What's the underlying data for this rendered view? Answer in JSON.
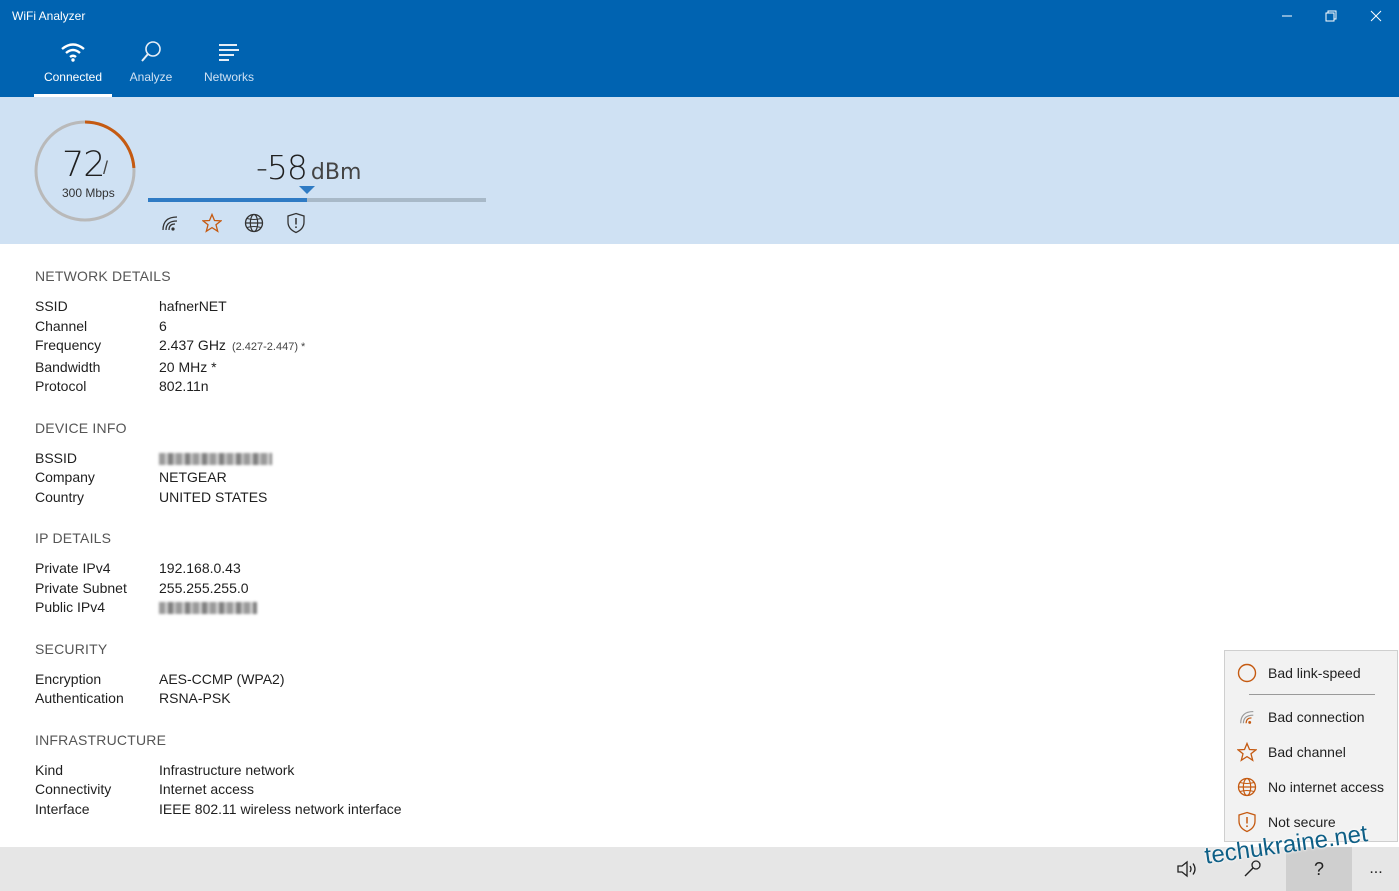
{
  "window": {
    "title": "WiFi Analyzer",
    "controls": [
      "minimize-icon",
      "restore-icon",
      "close-icon"
    ]
  },
  "nav": {
    "tabs": [
      {
        "label": "Connected",
        "icon": "wifi-icon",
        "active": true
      },
      {
        "label": "Analyze",
        "icon": "magnifier-icon",
        "active": false
      },
      {
        "label": "Networks",
        "icon": "list-icon",
        "active": false
      }
    ]
  },
  "status": {
    "link_speed": "72",
    "slash": "/",
    "max_speed": "300 Mbps",
    "link_speed_fraction": 0.24,
    "signal_dbm": "-58",
    "signal_unit": "dBm",
    "signal_level_fraction": 0.47,
    "icons": [
      "connection-icon",
      "star-icon",
      "globe-icon",
      "shield-icon"
    ]
  },
  "details": {
    "network": {
      "title": "NETWORK DETAILS",
      "rows": [
        {
          "label": "SSID",
          "value": "hafnerNET"
        },
        {
          "label": "Channel",
          "value": "6"
        },
        {
          "label": "Frequency",
          "value": "2.437 GHz",
          "extra": "(2.427-2.447) *"
        },
        {
          "label": "Bandwidth",
          "value": "20 MHz *"
        },
        {
          "label": "Protocol",
          "value": "802.11n"
        }
      ]
    },
    "device": {
      "title": "DEVICE INFO",
      "rows": [
        {
          "label": "BSSID",
          "value": ""
        },
        {
          "label": "Company",
          "value": "NETGEAR"
        },
        {
          "label": "Country",
          "value": "UNITED STATES"
        }
      ]
    },
    "ip": {
      "title": "IP DETAILS",
      "rows": [
        {
          "label": "Private IPv4",
          "value": "192.168.0.43"
        },
        {
          "label": "Private Subnet",
          "value": "255.255.255.0"
        },
        {
          "label": "Public IPv4",
          "value": ""
        }
      ]
    },
    "security": {
      "title": "SECURITY",
      "rows": [
        {
          "label": "Encryption",
          "value": "AES-CCMP (WPA2)"
        },
        {
          "label": "Authentication",
          "value": "RSNA-PSK"
        }
      ]
    },
    "infrastructure": {
      "title": "INFRASTRUCTURE",
      "rows": [
        {
          "label": "Kind",
          "value": "Infrastructure network"
        },
        {
          "label": "Connectivity",
          "value": "Internet access"
        },
        {
          "label": "Interface",
          "value": "IEEE 802.11 wireless network interface"
        }
      ]
    }
  },
  "legend": {
    "items": [
      {
        "label": "Bad link-speed",
        "icon": "circle-icon"
      },
      {
        "label": "Bad connection",
        "icon": "connection-icon"
      },
      {
        "label": "Bad channel",
        "icon": "star-icon"
      },
      {
        "label": "No internet access",
        "icon": "globe-icon"
      },
      {
        "label": "Not secure",
        "icon": "shield-icon"
      }
    ]
  },
  "commandbar": {
    "buttons": [
      "speaker-icon",
      "tools-icon",
      "help-icon",
      "more-icon"
    ],
    "more_label": "..."
  },
  "watermark": "techukraine.net",
  "colors": {
    "accent": "#0063b1",
    "status_bg": "#cfe1f3",
    "warning_orange": "#c55a11",
    "signal_blue": "#2f7bc4"
  }
}
